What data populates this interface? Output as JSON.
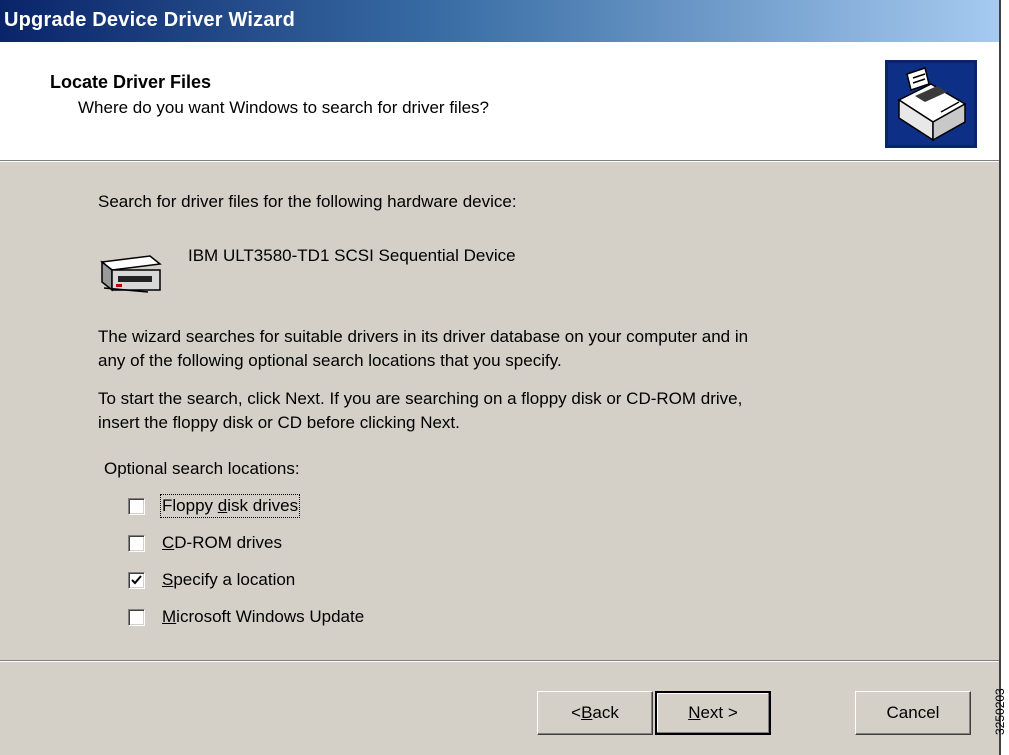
{
  "window": {
    "title": "Upgrade Device Driver Wizard"
  },
  "header": {
    "title": "Locate Driver Files",
    "subtitle": "Where do you want Windows to search for driver files?",
    "icon": "hardware-wizard-icon"
  },
  "body": {
    "intro": "Search for driver files for the following hardware device:",
    "device": {
      "icon": "tape-drive-icon",
      "name": "IBM ULT3580-TD1 SCSI Sequential Device"
    },
    "paragraph1_line1": "The wizard searches for suitable drivers in its driver database on your computer and in",
    "paragraph1_line2": "any of the following optional search locations that you specify.",
    "paragraph2_line1": "To start the search, click Next. If you are searching on a floppy disk or CD-ROM drive,",
    "paragraph2_line2": "insert the floppy disk or CD before clicking Next.",
    "options_label": "Optional search locations:",
    "options": [
      {
        "pre": "Floppy ",
        "key": "d",
        "post": "isk drives",
        "checked": false
      },
      {
        "pre": "",
        "key": "C",
        "post": "D-ROM drives",
        "checked": false
      },
      {
        "pre": "",
        "key": "S",
        "post": "pecify a location",
        "checked": true
      },
      {
        "pre": "",
        "key": "M",
        "post": "icrosoft Windows Update",
        "checked": false
      }
    ]
  },
  "buttons": {
    "back": {
      "pre": "< ",
      "key": "B",
      "post": "ack"
    },
    "next": {
      "pre": "",
      "key": "N",
      "post": "ext >"
    },
    "cancel": "Cancel"
  },
  "side_note": "3250203"
}
